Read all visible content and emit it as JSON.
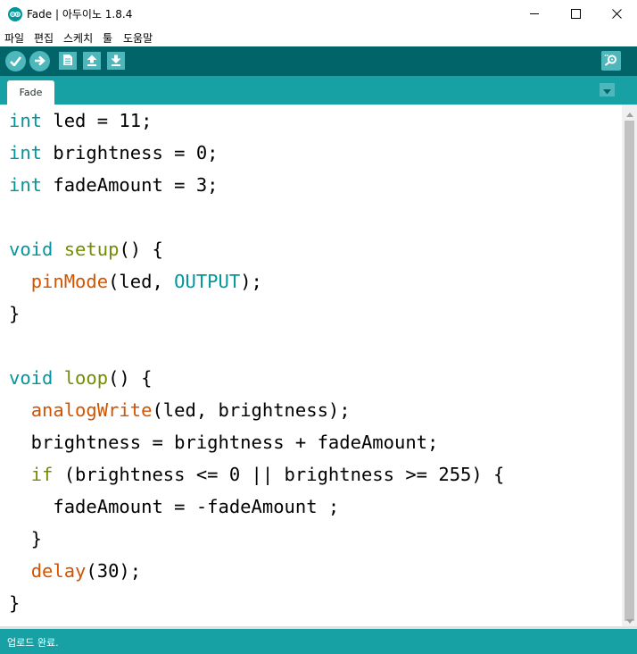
{
  "window": {
    "title": "Fade | 아두이노 1.8.4",
    "app_icon": "arduino-logo-icon",
    "controls": [
      "minimize-icon",
      "maximize-icon",
      "close-icon"
    ]
  },
  "menu": {
    "items": [
      "파일",
      "편집",
      "스케치",
      "툴",
      "도움말"
    ]
  },
  "toolbar": {
    "buttons": [
      "verify-icon",
      "upload-icon",
      "new-icon",
      "open-icon",
      "save-icon"
    ],
    "right_button": "serial-monitor-icon"
  },
  "tabs": {
    "active": "Fade",
    "menu_icon": "tab-menu-chevron-icon"
  },
  "editor": {
    "lines": [
      [
        {
          "t": "int",
          "c": "kw"
        },
        {
          "t": " led = 11;"
        }
      ],
      [
        {
          "t": "int",
          "c": "kw"
        },
        {
          "t": " brightness = 0;"
        }
      ],
      [
        {
          "t": "int",
          "c": "kw"
        },
        {
          "t": " fadeAmount = 3;"
        }
      ],
      [],
      [
        {
          "t": "void",
          "c": "kw"
        },
        {
          "t": " "
        },
        {
          "t": "setup",
          "c": "struct"
        },
        {
          "t": "() {"
        }
      ],
      [
        {
          "t": "  "
        },
        {
          "t": "pinMode",
          "c": "fn"
        },
        {
          "t": "(led, "
        },
        {
          "t": "OUTPUT",
          "c": "const"
        },
        {
          "t": ");"
        }
      ],
      [
        {
          "t": "}"
        }
      ],
      [],
      [
        {
          "t": "void",
          "c": "kw"
        },
        {
          "t": " "
        },
        {
          "t": "loop",
          "c": "struct"
        },
        {
          "t": "() {"
        }
      ],
      [
        {
          "t": "  "
        },
        {
          "t": "analogWrite",
          "c": "fn"
        },
        {
          "t": "(led, brightness);"
        }
      ],
      [
        {
          "t": "  brightness = brightness + fadeAmount;"
        }
      ],
      [
        {
          "t": "  "
        },
        {
          "t": "if",
          "c": "struct"
        },
        {
          "t": " (brightness <= 0 || brightness >= 255) {"
        }
      ],
      [
        {
          "t": "    fadeAmount = -fadeAmount ;"
        }
      ],
      [
        {
          "t": "  }"
        }
      ],
      [
        {
          "t": "  "
        },
        {
          "t": "delay",
          "c": "fn"
        },
        {
          "t": "(30);"
        }
      ],
      [
        {
          "t": "}"
        }
      ]
    ]
  },
  "status": {
    "message": "업로드 완료."
  },
  "colors": {
    "toolbar_bg": "#006468",
    "tab_bg": "#17a1a5",
    "button_bg": "#4db7bb",
    "keyword": "#00979c",
    "function": "#d35400",
    "structure": "#728e00"
  }
}
